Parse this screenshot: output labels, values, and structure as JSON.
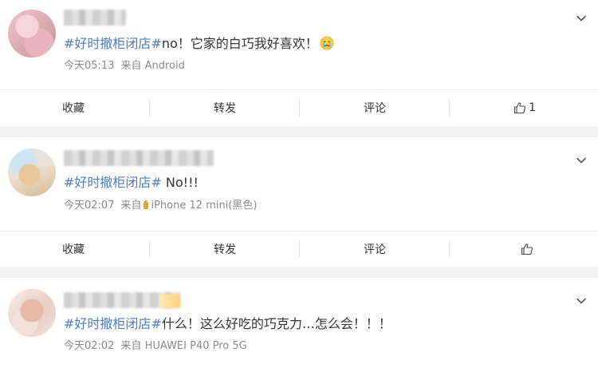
{
  "posts": [
    {
      "topic": "#好时撤柜闭店#",
      "text": "no！它家的白巧我好喜欢！",
      "emoji": "crying-face-icon",
      "time": "今天05:13",
      "source": "来自 Android",
      "actions": {
        "collect": "收藏",
        "repost": "转发",
        "comment": "评论",
        "like_count": "1"
      }
    },
    {
      "topic": "#好时撤柜闭店#",
      "text": " No!!!",
      "time": "今天02:07",
      "source_prefix": "来自",
      "source": "iPhone 12 mini(黑色)",
      "actions": {
        "collect": "收藏",
        "repost": "转发",
        "comment": "评论",
        "like_count": ""
      }
    },
    {
      "topic": "#好时撤柜闭店#",
      "text": "什么！这么好吃的巧克力…怎么会！！！",
      "time": "今天02:02",
      "source": "来自 HUAWEI P40 Pro 5G"
    }
  ],
  "colors": {
    "topic": "#4e7ec1",
    "text": "#333333",
    "meta": "#8a8a8a",
    "background": "#f2f2f2"
  }
}
